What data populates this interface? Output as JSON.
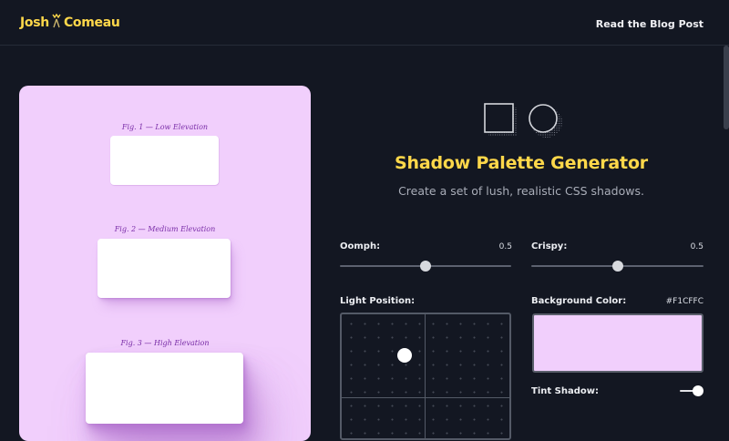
{
  "header": {
    "logo_first": "Josh",
    "logo_second": "Comeau",
    "blog_link": "Read the Blog Post"
  },
  "preview": {
    "fig1": "Fig. 1 — Low Elevation",
    "fig2": "Fig. 2 — Medium Elevation",
    "fig3": "Fig. 3 — High Elevation"
  },
  "hero": {
    "title": "Shadow Palette Generator",
    "subtitle": "Create a set of lush, realistic CSS shadows."
  },
  "controls": {
    "oomph": {
      "label": "Oomph:",
      "value": "0.5",
      "level": 0.5
    },
    "crispy": {
      "label": "Crispy:",
      "value": "0.5",
      "level": 0.5
    },
    "light_position": {
      "label": "Light Position:"
    },
    "background_color": {
      "label": "Background Color:",
      "value": "#F1CFFC"
    },
    "tint_shadow": {
      "label": "Tint Shadow:",
      "enabled": true
    }
  },
  "colors": {
    "accent": "#FFD84A",
    "page_bg": "#131722",
    "preview_bg": "#F1CFFC",
    "fig_label": "#7A2EA8"
  },
  "icons": [
    "logo-mark-icon",
    "square-shadow-icon",
    "circle-shadow-icon"
  ]
}
